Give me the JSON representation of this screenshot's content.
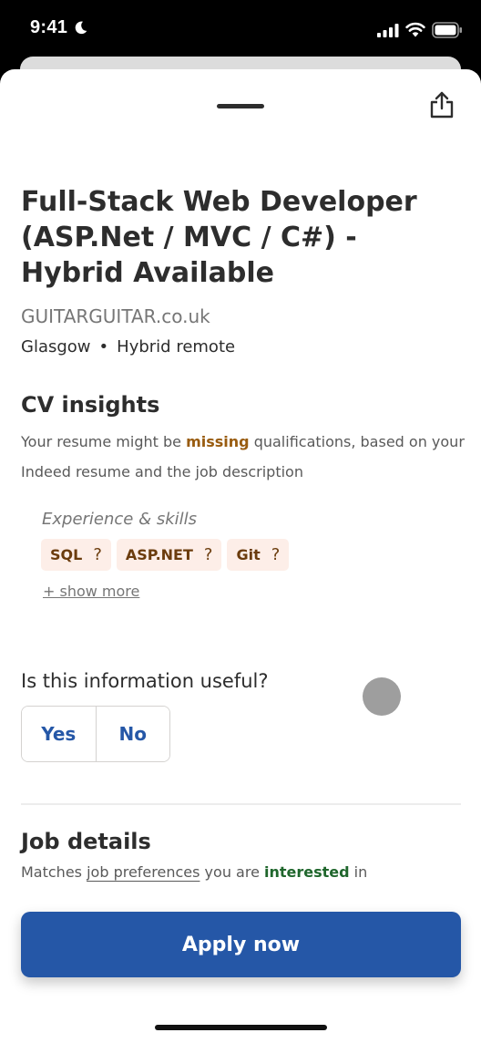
{
  "status_bar": {
    "time": "9:41",
    "icons": [
      "moon-icon",
      "signal-icon",
      "wifi-icon",
      "battery-icon"
    ]
  },
  "sheet": {
    "share_icon": "share-icon",
    "job_title": "Full-Stack Web Developer (ASP.Net / MVC / C#) - Hybrid Available",
    "company": "GUITARGUITAR.co.uk",
    "location": "Glasgow",
    "separator": "•",
    "work_type": "Hybrid remote"
  },
  "cv_insights": {
    "title": "CV insights",
    "text_before": "Your resume might be ",
    "highlight": "missing",
    "text_after": " qualifications, based on your Indeed resume and the job description",
    "skills_label": "Experience & skills",
    "skills": [
      {
        "label": "SQL",
        "help": "?"
      },
      {
        "label": "ASP.NET",
        "help": "?"
      },
      {
        "label": "Git",
        "help": "?"
      }
    ],
    "show_more": "+ show more"
  },
  "feedback": {
    "question": "Is this information useful?",
    "yes": "Yes",
    "no": "No"
  },
  "job_details": {
    "title": "Job details",
    "text_before": "Matches ",
    "link": "job preferences",
    "text_middle": " you are ",
    "highlight": "interested",
    "text_after": " in"
  },
  "apply": {
    "label": "Apply now"
  },
  "colors": {
    "accent": "#2557a7",
    "missing": "#995c10",
    "interested": "#1f662c",
    "chip_bg": "#fdeee8"
  }
}
